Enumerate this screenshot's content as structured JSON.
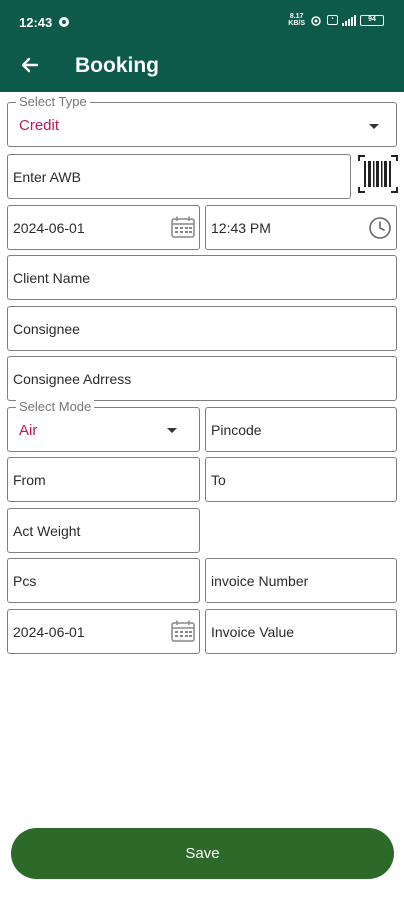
{
  "status_bar": {
    "time": "12:43",
    "net_speed_top": "8.17",
    "net_speed_bottom": "KB/S",
    "battery": "94"
  },
  "app_bar": {
    "title": "Booking",
    "back_icon": "arrow-left-icon"
  },
  "form": {
    "select_type": {
      "legend": "Select Type",
      "value": "Credit"
    },
    "awb": {
      "placeholder": "Enter AWB",
      "scan_icon": "barcode-icon"
    },
    "date1": {
      "value": "2024-06-01",
      "icon": "calendar-icon"
    },
    "time": {
      "value": "12:43 PM",
      "icon": "clock-icon"
    },
    "client_name": {
      "placeholder": "Client Name"
    },
    "consignee": {
      "placeholder": "Consignee"
    },
    "consignee_address": {
      "placeholder": "Consignee Adrress"
    },
    "select_mode": {
      "legend": "Select Mode",
      "value": "Air"
    },
    "pincode": {
      "placeholder": "Pincode"
    },
    "from": {
      "placeholder": "From"
    },
    "to": {
      "placeholder": "To"
    },
    "act_weight": {
      "placeholder": "Act Weight"
    },
    "pcs": {
      "placeholder": "Pcs"
    },
    "invoice_number": {
      "placeholder": "invoice Number"
    },
    "date2": {
      "value": "2024-06-01",
      "icon": "calendar-icon"
    },
    "invoice_value": {
      "placeholder": "Invoice Value"
    }
  },
  "save_label": "Save",
  "colors": {
    "app_bar": "#0e5a4a",
    "select_value": "#c2185b",
    "save_button": "#2d6a2a"
  }
}
